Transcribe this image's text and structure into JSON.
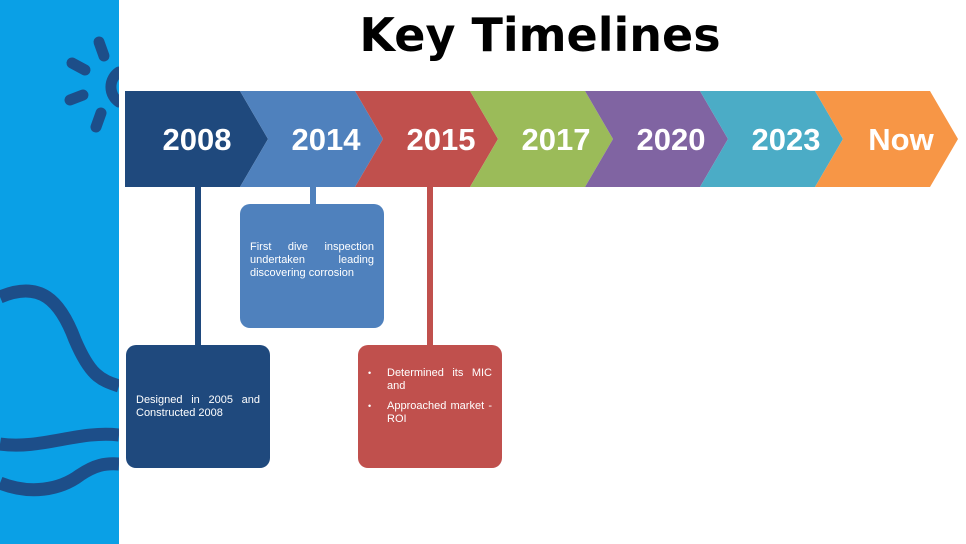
{
  "title": "Key Timelines",
  "timeline": {
    "segments": [
      {
        "label": "2008",
        "color": "#1f497d"
      },
      {
        "label": "2014",
        "color": "#4f81bd"
      },
      {
        "label": "2015",
        "color": "#c0504d"
      },
      {
        "label": "2017",
        "color": "#9bbb59"
      },
      {
        "label": "2020",
        "color": "#8064a2"
      },
      {
        "label": "2023",
        "color": "#4bacc6"
      },
      {
        "label": "Now",
        "color": "#f79646"
      }
    ]
  },
  "events": {
    "e2008": {
      "year": "2008",
      "text": "Designed in 2005 and Constructed 2008",
      "color": "#1f497d"
    },
    "e2014": {
      "year": "2014",
      "text": "First dive inspection undertaken leading discovering corrosion",
      "color": "#4f81bd"
    },
    "e2015": {
      "year": "2015",
      "bullets": [
        "Determined its MIC and",
        "Approached market - ROI"
      ],
      "color": "#c0504d"
    }
  },
  "theme": {
    "sidebar_color": "#0aa0e6",
    "sidebar_accent": "#1d4e89"
  }
}
